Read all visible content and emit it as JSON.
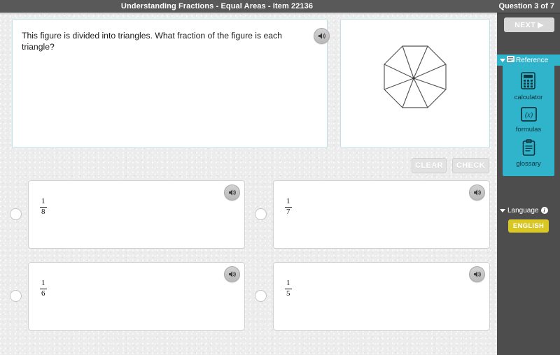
{
  "header": {
    "title": "Understanding Fractions - Equal Areas - Item 22136",
    "question_counter": "Question 3 of 7"
  },
  "prompt": {
    "text": "This figure is divided into triangles. What fraction of the figure is each triangle?",
    "speaker_icon": "speaker-icon"
  },
  "figure": {
    "shape": "octagon",
    "triangle_count": 8,
    "description": "Regular octagon divided into 8 triangles by segments from each vertex to the center",
    "stroke_color": "#555555"
  },
  "actions": {
    "clear_label": "CLEAR",
    "check_label": "CHECK"
  },
  "options": [
    {
      "id": "a",
      "numerator": "1",
      "denominator": "8",
      "selected": false,
      "speaker_icon": "speaker-icon"
    },
    {
      "id": "b",
      "numerator": "1",
      "denominator": "7",
      "selected": false,
      "speaker_icon": "speaker-icon"
    },
    {
      "id": "c",
      "numerator": "1",
      "denominator": "6",
      "selected": false,
      "speaker_icon": "speaker-icon"
    },
    {
      "id": "d",
      "numerator": "1",
      "denominator": "5",
      "selected": false,
      "speaker_icon": "speaker-icon"
    }
  ],
  "sidebar": {
    "next_label": "NEXT",
    "next_arrow": "▶",
    "reference": {
      "title": "Reference",
      "title_icon": "reference-book-icon",
      "accent_color": "#2fb4cc",
      "tools": [
        {
          "label": "calculator",
          "icon": "calculator-icon"
        },
        {
          "label": "formulas",
          "icon": "formulas-icon"
        },
        {
          "label": "glossary",
          "icon": "glossary-clipboard-icon"
        }
      ]
    },
    "language": {
      "title": "Language",
      "info_icon": "info-icon",
      "selected": "ENGLISH",
      "button_color": "#d9c723"
    }
  }
}
